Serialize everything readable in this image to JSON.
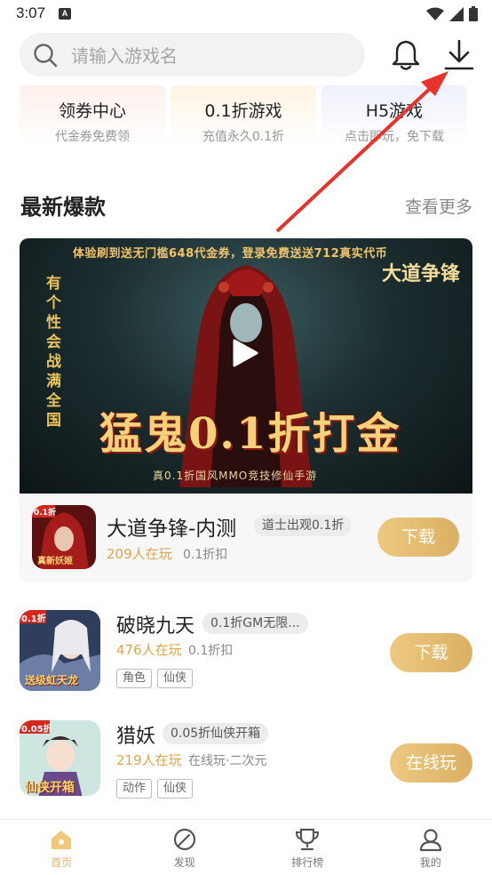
{
  "status": {
    "time": "3:07",
    "notif_glyph": "A"
  },
  "header": {
    "search_placeholder": "请输入游戏名"
  },
  "features": [
    {
      "title": "领券中心",
      "subtitle": "代金券免费领"
    },
    {
      "title": "0.1折游戏",
      "subtitle": "充值永久0.1折"
    },
    {
      "title": "H5游戏",
      "subtitle": "点击即玩，免下载"
    }
  ],
  "section": {
    "title": "最新爆款",
    "more": "查看更多"
  },
  "banner": {
    "top_text": "体验刷到送无门槛648代金券，登录免费送送712真实代币",
    "left_text": "有个性会战满全国",
    "right_text": "大道争锋",
    "big_text": "猛鬼0.1折打金",
    "sub_text": "真0.1折国风MMO竞技修仙手游"
  },
  "featured_game": {
    "name": "大道争锋-内测",
    "tag": "道士出观0.1折",
    "players": "209人在玩",
    "discount": "0.1折扣",
    "button": "下载",
    "icon_badge": "0.1折",
    "icon_caption": "真新妖姬"
  },
  "games": [
    {
      "name": "破晓九天",
      "tag": "0.1折GM无限...",
      "players": "476人在玩",
      "extra": "0.1折扣",
      "chips": [
        "角色",
        "仙侠"
      ],
      "button": "下载",
      "icon_badge": "0.1折",
      "icon_caption": "送级虹天龙"
    },
    {
      "name": "猎妖",
      "tag": "0.05折仙侠开箱",
      "players": "219人在玩",
      "extra": "在线玩·二次元",
      "chips": [
        "动作",
        "仙侠"
      ],
      "button": "在线玩",
      "icon_badge": "0.05折",
      "icon_caption": "仙侠开箱"
    }
  ],
  "nav": [
    {
      "label": "首页",
      "icon": "home-icon",
      "active": true
    },
    {
      "label": "发现",
      "icon": "compass-icon",
      "active": false
    },
    {
      "label": "排行榜",
      "icon": "trophy-icon",
      "active": false
    },
    {
      "label": "我的",
      "icon": "user-icon",
      "active": false
    }
  ],
  "colors": {
    "accent": "#dab064",
    "accent_text": "#d9a848",
    "arrow": "#e8322c"
  }
}
